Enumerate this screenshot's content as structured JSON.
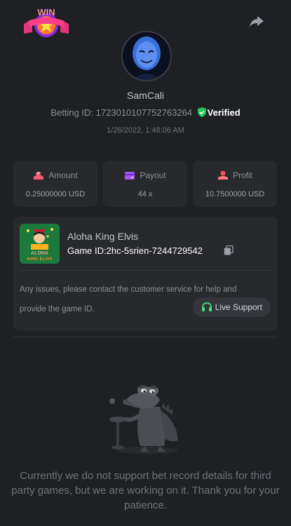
{
  "header": {
    "badge_text": "WIN",
    "share_icon": "share-icon"
  },
  "user": {
    "username": "SamCali",
    "betting_id_label": "Betting ID:",
    "betting_id": "1723010107752763264",
    "verified_label": "Verified",
    "timestamp": "1/26/2022, 1:48:06 AM"
  },
  "stats": [
    {
      "icon": "amount-icon",
      "label": "Amount",
      "value": "0.25000000 USD"
    },
    {
      "icon": "payout-icon",
      "label": "Payout",
      "value": "44 x"
    },
    {
      "icon": "profit-icon",
      "label": "Profit",
      "value": "10.7500000 USD"
    }
  ],
  "game": {
    "thumbnail_title": "ALOHA KING ELVIS",
    "name": "Aloha King Elvis",
    "id_label": "Game ID:",
    "id": "2hc-5srien-7244729542",
    "notice": "Any issues, please contact the customer service for help and provide the game ID.",
    "support_label": "Live Support"
  },
  "footer": {
    "message": "Currently we do not support bet record details for third party games, but we are working on it. Thank you for your patience."
  },
  "colors": {
    "background": "#1f2023",
    "card": "#28292d",
    "verified_green": "#22c55e",
    "amount_pink": "#ff5a7a",
    "payout_purple": "#a855f7",
    "profit_red": "#ff4d5a",
    "support_green": "#4ade80"
  }
}
